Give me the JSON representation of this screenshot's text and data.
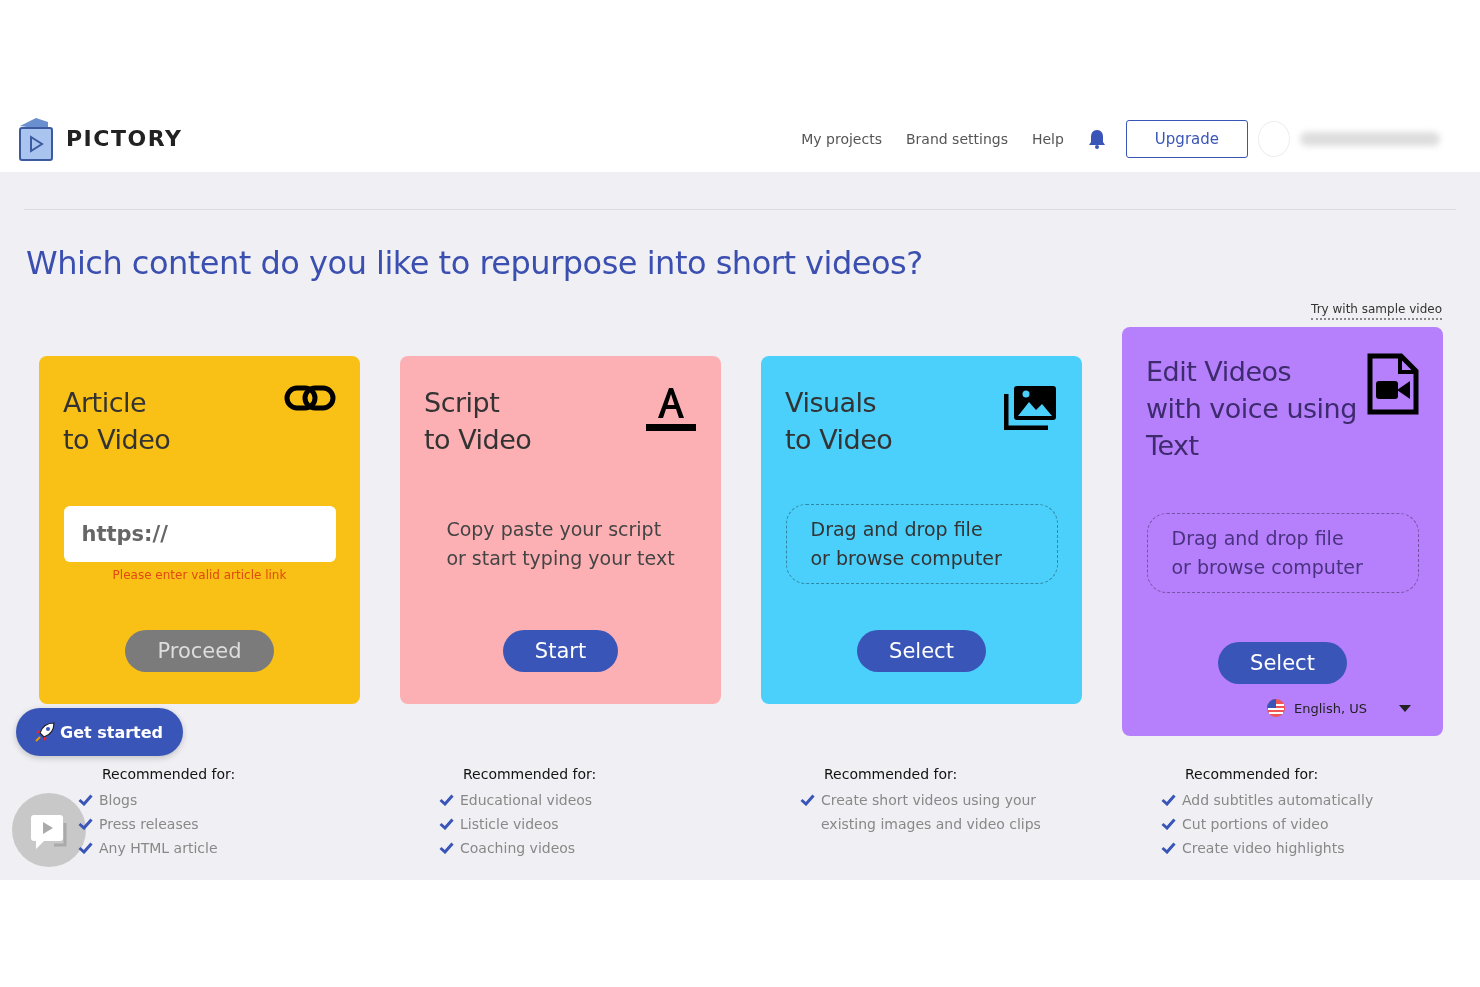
{
  "header": {
    "logo": "PICTORY",
    "nav": [
      "My projects",
      "Brand settings",
      "Help"
    ],
    "upgrade": "Upgrade"
  },
  "heading": "Which content do you like to repurpose into short videos?",
  "sample_link": "Try with sample video",
  "cards": [
    {
      "kind": "url",
      "title": [
        "Article",
        "to Video"
      ],
      "color": "#f9c015",
      "placeholder": "https://",
      "error": "Please enter valid article link",
      "button": "Proceed",
      "disabled": true
    },
    {
      "kind": "text",
      "title": [
        "Script",
        "to Video"
      ],
      "color": "#fdb0b4",
      "text": [
        "Copy paste your script",
        "or start typing your text"
      ],
      "button": "Start",
      "disabled": false
    },
    {
      "kind": "drop",
      "title": [
        "Visuals",
        "to Video"
      ],
      "color": "#4bd0fc",
      "text": [
        "Drag and drop file",
        "or browse computer"
      ],
      "button": "Select",
      "disabled": false
    },
    {
      "kind": "drop",
      "title": [
        "Edit Videos",
        "with voice using",
        "Text"
      ],
      "color": "#b67ffc",
      "text": [
        "Drag and drop file",
        "or browse computer"
      ],
      "button": "Select",
      "disabled": false,
      "language": "English, US"
    }
  ],
  "recommendations": [
    {
      "title": "Recommended for:",
      "items": [
        "Blogs",
        "Press releases",
        "Any HTML article"
      ]
    },
    {
      "title": "Recommended for:",
      "items": [
        "Educational videos",
        "Listicle videos",
        "Coaching videos"
      ]
    },
    {
      "title": "Recommended for:",
      "items": [
        "Create short videos using your existing images and video clips"
      ]
    },
    {
      "title": "Recommended for:",
      "items": [
        "Add subtitles automatically",
        "Cut portions of video",
        "Create video highlights"
      ]
    }
  ],
  "get_started": "Get started"
}
